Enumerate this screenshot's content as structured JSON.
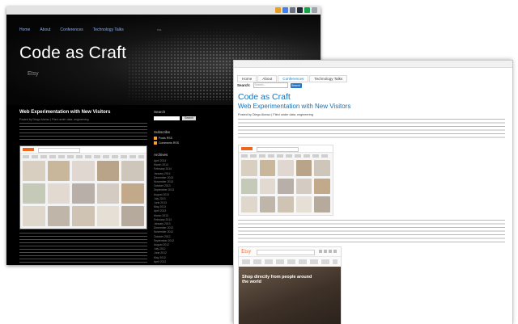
{
  "dark_window": {
    "nav": [
      "Home",
      "About",
      "Conferences",
      "Technology Talks"
    ],
    "nav_right": "rss",
    "site_title": "Code as Craft",
    "tagline": "Etsy",
    "post": {
      "title": "Web Experimentation with New Visitors",
      "meta": "Posted by Diego Alonso | Filed under data, engineering"
    },
    "sidebar": {
      "search_heading": "Search",
      "search_button": "Search",
      "subscribe_heading": "Subscribe",
      "subscribe_items": [
        "Posts RSS",
        "Comments RSS"
      ],
      "archives_heading": "Archives",
      "archives": [
        "April 2014",
        "March 2014",
        "February 2014",
        "January 2014",
        "December 2013",
        "November 2013",
        "October 2013",
        "September 2013",
        "August 2013",
        "July 2013",
        "June 2013",
        "May 2013",
        "April 2013",
        "March 2013",
        "February 2013",
        "January 2013",
        "December 2012",
        "November 2012",
        "October 2012",
        "September 2012",
        "August 2012",
        "July 2012",
        "June 2012",
        "May 2012",
        "April 2012"
      ]
    }
  },
  "light_window": {
    "tabs": [
      "Home",
      "About",
      "Conferences",
      "Technology Talks"
    ],
    "active_tab": "Conferences",
    "search_label": "Search:",
    "search_placeholder": "Search...",
    "search_button": "Search",
    "site_title": "Code as Craft",
    "post_title": "Web Experimentation with New Visitors",
    "meta": "Posted by Diego Alonso | Filed under data, engineering",
    "etsy_logo": "Etsy",
    "etsy_hero_text": "Shop directly from people around the world"
  },
  "colors": {
    "dark_bg": "#000000",
    "dark_link": "#7fb2ff",
    "light_accent": "#1671b8",
    "etsy_orange": "#f1641e",
    "search_button": "#2a75c6"
  }
}
